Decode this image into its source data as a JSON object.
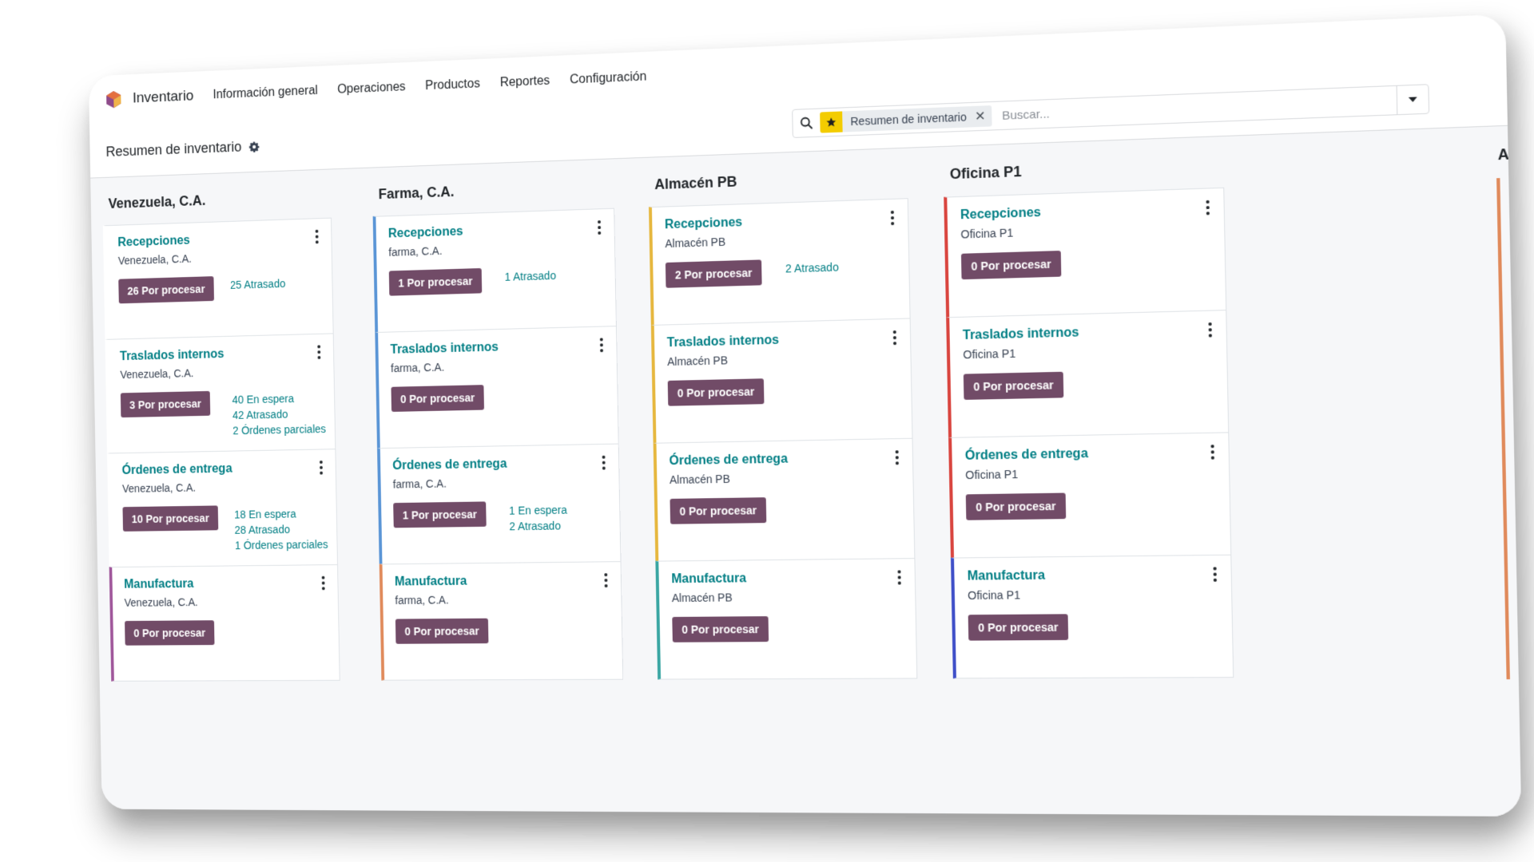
{
  "navbar": {
    "app_name": "Inventario",
    "menu": [
      "Información general",
      "Operaciones",
      "Productos",
      "Reportes",
      "Configuración"
    ]
  },
  "control": {
    "breadcrumb": "Resumen de inventario",
    "search": {
      "facet_label": "Resumen de inventario",
      "facet_close": "✕",
      "placeholder": "Buscar..."
    }
  },
  "colors": {
    "brand_button": "#714b67",
    "link_teal": "#017e84",
    "logo": [
      "#e46f3f",
      "#8e4a8a",
      "#f0b34a"
    ],
    "facet_star": "#f3cc00"
  },
  "columns": [
    {
      "title": "Venezuela, C.A.",
      "cards": [
        {
          "title": "Recepciones",
          "subtitle": "Venezuela, C.A.",
          "button": "26 Por procesar",
          "stats": [
            "25 Atrasado"
          ],
          "accent": "#ffffff"
        },
        {
          "title": "Traslados internos",
          "subtitle": "Venezuela, C.A.",
          "button": "3 Por procesar",
          "stats": [
            "40 En espera",
            "42 Atrasado",
            "2 Órdenes parciales"
          ],
          "accent": "#ffffff"
        },
        {
          "title": "Órdenes de entrega",
          "subtitle": "Venezuela, C.A.",
          "button": "10 Por procesar",
          "stats": [
            "18 En espera",
            "28 Atrasado",
            "1 Órdenes parciales"
          ],
          "accent": "#ffffff"
        },
        {
          "title": "Manufactura",
          "subtitle": "Venezuela, C.A.",
          "button": "0 Por procesar",
          "stats": [],
          "accent": "#a0579b"
        }
      ]
    },
    {
      "title": "Farma, C.A.",
      "cards": [
        {
          "title": "Recepciones",
          "subtitle": "farma, C.A.",
          "button": "1 Por procesar",
          "stats": [
            "1 Atrasado"
          ],
          "accent": "#5a95d6"
        },
        {
          "title": "Traslados internos",
          "subtitle": "farma, C.A.",
          "button": "0 Por procesar",
          "stats": [],
          "accent": "#5a95d6"
        },
        {
          "title": "Órdenes de entrega",
          "subtitle": "farma, C.A.",
          "button": "1 Por procesar",
          "stats": [
            "1 En espera",
            "2 Atrasado"
          ],
          "accent": "#5a95d6"
        },
        {
          "title": "Manufactura",
          "subtitle": "farma, C.A.",
          "button": "0 Por procesar",
          "stats": [],
          "accent": "#e08a5b"
        }
      ]
    },
    {
      "title": "Almacén PB",
      "cards": [
        {
          "title": "Recepciones",
          "subtitle": "Almacén PB",
          "button": "2 Por procesar",
          "stats": [
            "2 Atrasado"
          ],
          "accent": "#e6b73e"
        },
        {
          "title": "Traslados internos",
          "subtitle": "Almacén PB",
          "button": "0 Por procesar",
          "stats": [],
          "accent": "#e6b73e"
        },
        {
          "title": "Órdenes de entrega",
          "subtitle": "Almacén PB",
          "button": "0 Por procesar",
          "stats": [],
          "accent": "#e6b73e"
        },
        {
          "title": "Manufactura",
          "subtitle": "Almacén PB",
          "button": "0 Por procesar",
          "stats": [],
          "accent": "#3aa6a3"
        }
      ]
    },
    {
      "title": "Oficina P1",
      "cards": [
        {
          "title": "Recepciones",
          "subtitle": "Oficina P1",
          "button": "0 Por procesar",
          "stats": [],
          "accent": "#d9453f"
        },
        {
          "title": "Traslados internos",
          "subtitle": "Oficina P1",
          "button": "0 Por procesar",
          "stats": [],
          "accent": "#d9453f"
        },
        {
          "title": "Órdenes de entrega",
          "subtitle": "Oficina P1",
          "button": "0 Por procesar",
          "stats": [],
          "accent": "#d9453f"
        },
        {
          "title": "Manufactura",
          "subtitle": "Oficina P1",
          "button": "0 Por procesar",
          "stats": [],
          "accent": "#3f4fc8"
        }
      ]
    }
  ],
  "edge_column": {
    "title": "A",
    "accent": "#e08a5b"
  }
}
